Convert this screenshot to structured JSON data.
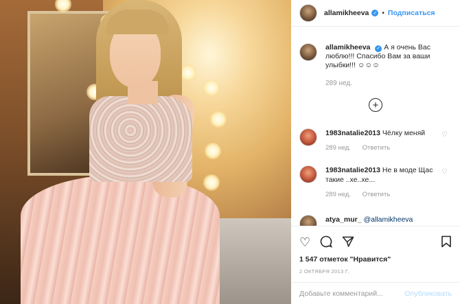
{
  "post": {
    "username": "allamikheeva",
    "follow_label": "Подписаться",
    "dot": "•",
    "verified_glyph": "✓"
  },
  "caption": {
    "username": "allamikheeva",
    "text": "А я очень Вас люблю!!! Спасибо Вам за ваши улыбки!!! ☺☺☺",
    "age": "289 нед."
  },
  "load_more_glyph": "+",
  "comments": [
    {
      "username": "1983natalie2013",
      "text": "Чёлку меняй",
      "age": "289 нед.",
      "reply": "Ответить"
    },
    {
      "username": "1983natalie2013",
      "text": "Не в моде Щас такие ..хе..хе...",
      "age": "289 нед.",
      "reply": "Ответить"
    },
    {
      "username": "atya_mur_",
      "text": "@allamikheeva",
      "age": "",
      "reply": ""
    }
  ],
  "actions": {
    "like_icon": "heart-icon",
    "comment_icon": "comment-icon",
    "share_icon": "share-icon",
    "save_icon": "bookmark-icon"
  },
  "likes": "1 547 отметок \"Нравится\"",
  "date": "2 ОКТЯБРЯ 2013 Г.",
  "add_comment": {
    "placeholder": "Добавьте комментарий...",
    "post_label": "Опубликовать"
  }
}
